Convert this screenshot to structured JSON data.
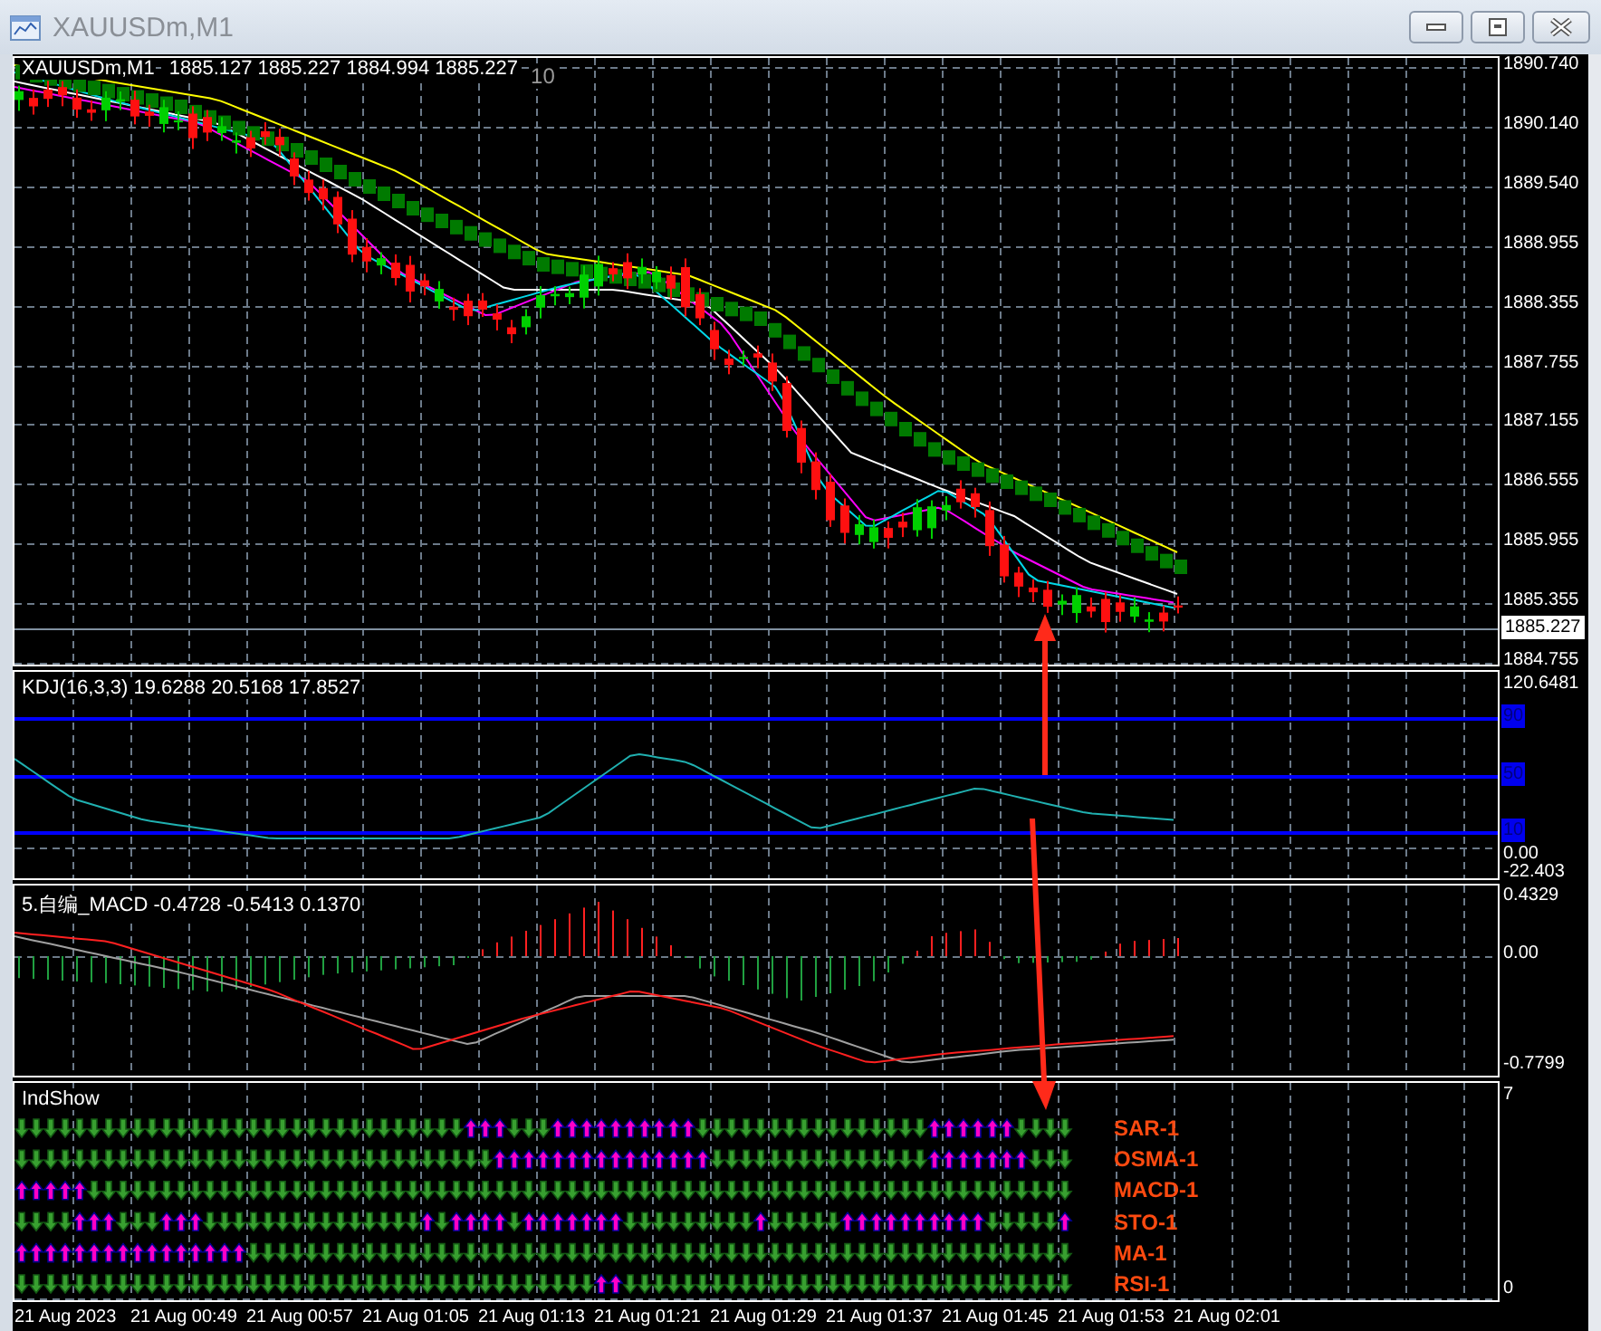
{
  "window": {
    "title": "XAUUSDm,M1"
  },
  "main_pane": {
    "symbol": "XAUUSDm,M1",
    "ohlc": "1885.127 1885.227 1884.994 1885.227",
    "marker": "10",
    "axis_labels": [
      "1890.740",
      "1890.140",
      "1889.540",
      "1888.955",
      "1888.355",
      "1887.755",
      "1887.155",
      "1886.555",
      "1885.955",
      "1885.355",
      "1884.755"
    ],
    "current_price": "1885.227"
  },
  "kdj_pane": {
    "title": "KDJ(16,3,3) 19.6288 20.5168 17.8527",
    "axis_labels": [
      "120.6481",
      "0.00",
      "-22.403"
    ],
    "levels": [
      "90",
      "50",
      "10"
    ]
  },
  "macd_pane": {
    "title": "5.自编_MACD -0.4728 -0.5413 0.1370",
    "axis_labels": [
      "0.4329",
      "0.00",
      "-0.7799"
    ]
  },
  "indshow_pane": {
    "title": "IndShow",
    "axis_labels": [
      "7",
      "0"
    ],
    "rows": [
      {
        "label": "SAR-1",
        "up": [
          false,
          false,
          false,
          false,
          false,
          false,
          false,
          false,
          false,
          false,
          false,
          false,
          false,
          false,
          false,
          false,
          false,
          false,
          false,
          false,
          false,
          false,
          false,
          false,
          false,
          false,
          false,
          false,
          false,
          false,
          false,
          true,
          true,
          true,
          false,
          false,
          false,
          true,
          true,
          true,
          true,
          true,
          true,
          true,
          true,
          true,
          true,
          false,
          false,
          false,
          false,
          false,
          false,
          false,
          false,
          false,
          false,
          false,
          false,
          false,
          false,
          false,
          false,
          true,
          true,
          true,
          true,
          true,
          true,
          false,
          false,
          false,
          false
        ]
      },
      {
        "label": "OSMA-1",
        "up": [
          false,
          false,
          false,
          false,
          false,
          false,
          false,
          false,
          false,
          false,
          false,
          false,
          false,
          false,
          false,
          false,
          false,
          false,
          false,
          false,
          false,
          false,
          false,
          false,
          false,
          false,
          false,
          false,
          false,
          false,
          false,
          false,
          false,
          true,
          true,
          true,
          true,
          true,
          true,
          true,
          true,
          true,
          true,
          true,
          true,
          true,
          true,
          true,
          false,
          false,
          false,
          false,
          false,
          false,
          false,
          false,
          false,
          false,
          false,
          false,
          false,
          false,
          false,
          true,
          true,
          true,
          true,
          true,
          true,
          true,
          false,
          false,
          false
        ]
      },
      {
        "label": "MACD-1",
        "up": [
          true,
          true,
          true,
          true,
          true,
          false,
          false,
          false,
          false,
          false,
          false,
          false,
          false,
          false,
          false,
          false,
          false,
          false,
          false,
          false,
          false,
          false,
          false,
          false,
          false,
          false,
          false,
          false,
          false,
          false,
          false,
          false,
          false,
          false,
          false,
          false,
          false,
          false,
          false,
          false,
          false,
          false,
          false,
          false,
          false,
          false,
          false,
          false,
          false,
          false,
          false,
          false,
          false,
          false,
          false,
          false,
          false,
          false,
          false,
          false,
          false,
          false,
          false,
          false,
          false,
          false,
          false,
          false,
          false,
          false,
          false,
          false,
          false
        ]
      },
      {
        "label": "STO-1",
        "up": [
          false,
          false,
          false,
          false,
          true,
          true,
          true,
          false,
          false,
          false,
          true,
          true,
          true,
          false,
          false,
          false,
          false,
          false,
          false,
          false,
          false,
          false,
          false,
          false,
          false,
          false,
          false,
          false,
          true,
          false,
          true,
          true,
          true,
          true,
          false,
          true,
          true,
          true,
          true,
          true,
          true,
          true,
          false,
          false,
          false,
          false,
          false,
          false,
          false,
          false,
          false,
          true,
          false,
          false,
          false,
          false,
          false,
          true,
          true,
          true,
          true,
          true,
          true,
          true,
          true,
          true,
          true,
          false,
          false,
          false,
          false,
          false,
          true
        ]
      },
      {
        "label": "MA-1",
        "up": [
          true,
          true,
          true,
          true,
          true,
          true,
          true,
          true,
          true,
          true,
          true,
          true,
          true,
          true,
          true,
          true,
          false,
          false,
          false,
          false,
          false,
          false,
          false,
          false,
          false,
          false,
          false,
          false,
          false,
          false,
          false,
          false,
          false,
          false,
          false,
          false,
          false,
          false,
          false,
          false,
          false,
          false,
          false,
          false,
          false,
          false,
          false,
          false,
          false,
          false,
          false,
          false,
          false,
          false,
          false,
          false,
          false,
          false,
          false,
          false,
          false,
          false,
          false,
          false,
          false,
          false,
          false,
          false,
          false,
          false,
          false,
          false,
          false
        ]
      },
      {
        "label": "RSI-1",
        "up": [
          false,
          false,
          false,
          false,
          false,
          false,
          false,
          false,
          false,
          false,
          false,
          false,
          false,
          false,
          false,
          false,
          false,
          false,
          false,
          false,
          false,
          false,
          false,
          false,
          false,
          false,
          false,
          false,
          false,
          false,
          false,
          false,
          false,
          false,
          false,
          false,
          false,
          false,
          false,
          false,
          true,
          true,
          false,
          false,
          false,
          false,
          false,
          false,
          false,
          false,
          false,
          false,
          false,
          false,
          false,
          false,
          false,
          false,
          false,
          false,
          false,
          false,
          false,
          false,
          false,
          false,
          false,
          false,
          false,
          false,
          false,
          false,
          false
        ]
      }
    ]
  },
  "time_axis": [
    "21 Aug 2023",
    "21 Aug 00:49",
    "21 Aug 00:57",
    "21 Aug 01:05",
    "21 Aug 01:13",
    "21 Aug 01:21",
    "21 Aug 01:29",
    "21 Aug 01:37",
    "21 Aug 01:45",
    "21 Aug 01:53",
    "21 Aug 02:01"
  ]
}
